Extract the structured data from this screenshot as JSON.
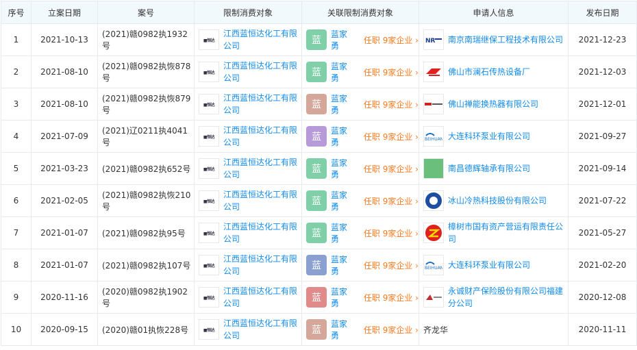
{
  "headers": [
    "序号",
    "立案日期",
    "案号",
    "限制消费对象",
    "关联限制消费对象",
    "申请人信息",
    "发布日期"
  ],
  "rows": [
    {
      "no": "1",
      "date": "2021-10-13",
      "case": "(2021)赣0982执1932号",
      "target": "江西蓝恒达化工有限公司",
      "avatar": "蓝",
      "avatar_color": "#7fd0a8",
      "person": "蓝家勇",
      "role": "任职 9家企业 ›",
      "applicant": "南京南瑞继保工程技术有限公司",
      "applicant_logo": "nr",
      "pub": "2021-12-23"
    },
    {
      "no": "2",
      "date": "2021-08-10",
      "case": "(2021)赣0982执恢878号",
      "target": "江西蓝恒达化工有限公司",
      "avatar": "蓝",
      "avatar_color": "#7fd0a8",
      "person": "蓝家勇",
      "role": "任职 9家企业 ›",
      "applicant": "佛山市澜石传热设备厂",
      "applicant_logo": "red-s",
      "pub": "2021-12-03"
    },
    {
      "no": "3",
      "date": "2021-08-10",
      "case": "(2021)赣0982执恢879号",
      "target": "江西蓝恒达化工有限公司",
      "avatar": "蓝",
      "avatar_color": "#d4a79a",
      "person": "蓝家勇",
      "role": "任职 9家企业 ›",
      "applicant": "佛山禅能换热器有限公司",
      "applicant_logo": "red-line",
      "pub": "2021-12-01"
    },
    {
      "no": "4",
      "date": "2021-07-09",
      "case": "(2021)辽0211执4041号",
      "target": "江西蓝恒达化工有限公司",
      "avatar": "蓝",
      "avatar_color": "#b79ad9",
      "person": "蓝家勇",
      "role": "任职 9家企业 ›",
      "applicant": "大连科环泵业有限公司",
      "applicant_logo": "kh",
      "pub": "2021-09-27"
    },
    {
      "no": "5",
      "date": "2021-03-23",
      "case": "(2021)赣0982执652号",
      "target": "江西蓝恒达化工有限公司",
      "avatar": "蓝",
      "avatar_color": "#7fd0a8",
      "person": "蓝家勇",
      "role": "任职 9家企业 ›",
      "applicant": "南昌德辉轴承有限公司",
      "applicant_logo": "green",
      "pub": "2021-09-14"
    },
    {
      "no": "6",
      "date": "2021-02-05",
      "case": "(2021)赣0982执恢210号",
      "target": "江西蓝恒达化工有限公司",
      "avatar": "蓝",
      "avatar_color": "#7fd0a8",
      "person": "蓝家勇",
      "role": "任职 9家企业 ›",
      "applicant": "冰山冷热科技股份有限公司",
      "applicant_logo": "blue-round",
      "pub": "2021-07-22"
    },
    {
      "no": "7",
      "date": "2021-01-07",
      "case": "(2021)赣0982执95号",
      "target": "江西蓝恒达化工有限公司",
      "avatar": "蓝",
      "avatar_color": "#7fd0a8",
      "person": "蓝家勇",
      "role": "任职 9家企业 ›",
      "applicant": "樟树市国有资产营运有限责任公司",
      "applicant_logo": "red-z",
      "pub": "2021-05-27"
    },
    {
      "no": "8",
      "date": "2021-01-07",
      "case": "(2021)赣0982执107号",
      "target": "江西蓝恒达化工有限公司",
      "avatar": "蓝",
      "avatar_color": "#8aa0d0",
      "person": "蓝家勇",
      "role": "任职 9家企业 ›",
      "applicant": "大连科环泵业有限公司",
      "applicant_logo": "kh",
      "pub": "2021-02-20"
    },
    {
      "no": "9",
      "date": "2020-11-16",
      "case": "(2020)赣0982执1902号",
      "target": "江西蓝恒达化工有限公司",
      "avatar": "蓝",
      "avatar_color": "#e08a8a",
      "person": "蓝家勇",
      "role": "任职 9家企业 ›",
      "applicant": "永诚财产保险股份有限公司福建分公司",
      "applicant_logo": "yc",
      "pub": "2020-12-08"
    },
    {
      "no": "10",
      "date": "2020-09-15",
      "case": "(2020)赣01执恢228号",
      "target": "江西蓝恒达化工有限公司",
      "avatar": "蓝",
      "avatar_color": "#d4a79a",
      "person": "蓝家勇",
      "role": "任职 9家企业 ›",
      "applicant": "齐龙华",
      "applicant_logo": "",
      "pub": "2020-11-11"
    }
  ]
}
